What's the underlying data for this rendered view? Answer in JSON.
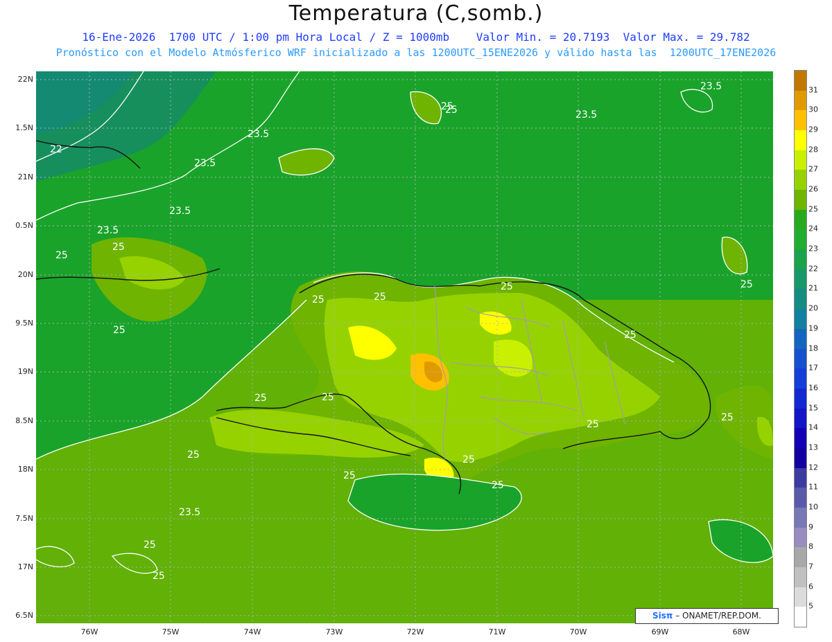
{
  "header": {
    "title": "Temperatura (C,somb.)",
    "line1": "16-Ene-2026  1700 UTC / 1:00 pm Hora Local / Z = 1000mb    Valor Min. = 20.7193  Valor Max. = 29.782",
    "line2": "Pronóstico con el Modelo Atmósferico WRF inicializado a las 1200UTC_15ENE2026 y válido hasta las  1200UTC_17ENE2026"
  },
  "axes": {
    "lat_labels": [
      "22N",
      "1.5N",
      "21N",
      "0.5N",
      "20N",
      "9.5N",
      "19N",
      "8.5N",
      "18N",
      "7.5N",
      "17N",
      "6.5N"
    ],
    "lon_labels": [
      "76W",
      "75W",
      "74W",
      "73W",
      "72W",
      "71W",
      "70W",
      "69W",
      "68W"
    ]
  },
  "colorbar": {
    "labels": [
      "31",
      "30",
      "29",
      "28",
      "27",
      "26",
      "25",
      "24",
      "23",
      "22",
      "21",
      "20",
      "19",
      "18",
      "17",
      "16",
      "15",
      "14",
      "13",
      "12",
      "11",
      "10",
      "9",
      "8",
      "7",
      "6",
      "5"
    ],
    "colors": [
      "#c07800",
      "#e09a00",
      "#ffc000",
      "#ffff00",
      "#c8f000",
      "#96d200",
      "#6eb400",
      "#28aa1e",
      "#1fae30",
      "#1aa34a",
      "#16996a",
      "#148c82",
      "#1480a0",
      "#1465c0",
      "#1450d0",
      "#143ed8",
      "#1428d2",
      "#1414c8",
      "#1400b4",
      "#1400a0",
      "#3c3ca0",
      "#5a5aaa",
      "#7878b4",
      "#9a8cc0",
      "#a8a8a8",
      "#c0c0c0",
      "#dcdcdc",
      "#ffffff"
    ]
  },
  "contour_labels": [
    "22",
    "23.5",
    "23.5",
    "23.5",
    "23.5",
    "23.5",
    "23.5",
    "23.5",
    "25",
    "25",
    "25",
    "25",
    "25",
    "25",
    "25",
    "25",
    "25",
    "25",
    "25",
    "25",
    "25",
    "25",
    "25",
    "25",
    "25",
    "25",
    "25",
    "25",
    "25"
  ],
  "credit": {
    "logo": "Sisπ",
    "text": " – ONAMET/REP.DOM."
  }
}
